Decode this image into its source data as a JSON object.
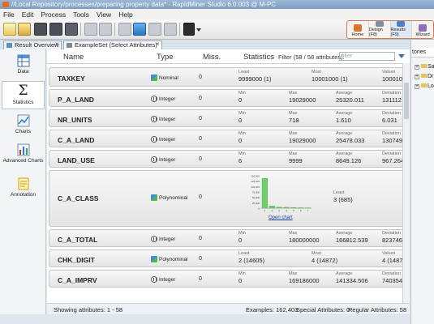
{
  "window": {
    "title": "//Local Repository/processes/preparing property data* - RapidMiner Studio 6.0.003 @ M-PC"
  },
  "menu": [
    "File",
    "Edit",
    "Process",
    "Tools",
    "View",
    "Help"
  ],
  "perspectives": [
    {
      "label": "Home",
      "icon": "home-icon"
    },
    {
      "label": "Design (F8)",
      "icon": "design-icon"
    },
    {
      "label": "Results (F9)",
      "icon": "results-icon"
    },
    {
      "label": "Wizard",
      "icon": "wizard-icon"
    }
  ],
  "tabs": [
    {
      "label": "Result Overview",
      "icon": "result-overview-icon"
    },
    {
      "label": "ExampleSet (Select Attributes)",
      "icon": "exampleset-icon"
    }
  ],
  "sidebar": [
    {
      "label": "Data",
      "icon": "data-table-icon"
    },
    {
      "label": "Statistics",
      "icon": "sigma-icon"
    },
    {
      "label": "Charts",
      "icon": "chart-icon"
    },
    {
      "label": "Advanced Charts",
      "icon": "advanced-chart-icon"
    },
    {
      "label": "Annotation",
      "icon": "annotation-icon"
    }
  ],
  "header": {
    "name": "Name",
    "type": "Type",
    "missing": "Miss.",
    "statistics": "Statistics",
    "filter_label": "Filter (58 / 58 attributes):",
    "filter_placeholder": "filter"
  },
  "rows": [
    {
      "name": "TAXKEY",
      "type": "Nominal",
      "missing": "0",
      "stats": [
        {
          "label": "Least",
          "value": "9999000 (1)"
        },
        {
          "label": "Most",
          "value": "10001000 (1)"
        },
        {
          "label": "Values",
          "value": "100010"
        }
      ]
    },
    {
      "name": "P_A_LAND",
      "type": "Integer",
      "missing": "0",
      "stats": [
        {
          "label": "Min",
          "value": "0"
        },
        {
          "label": "Max",
          "value": "19029000"
        },
        {
          "label": "Average",
          "value": "25320.011"
        },
        {
          "label": "Deviation",
          "value": "131112"
        }
      ]
    },
    {
      "name": "NR_UNITS",
      "type": "Integer",
      "missing": "0",
      "stats": [
        {
          "label": "Min",
          "value": "0"
        },
        {
          "label": "Max",
          "value": "718"
        },
        {
          "label": "Average",
          "value": "1.610"
        },
        {
          "label": "Deviation",
          "value": "6.031"
        }
      ]
    },
    {
      "name": "C_A_LAND",
      "type": "Integer",
      "missing": "0",
      "stats": [
        {
          "label": "Min",
          "value": "0"
        },
        {
          "label": "Max",
          "value": "19029000"
        },
        {
          "label": "Average",
          "value": "25478.033"
        },
        {
          "label": "Deviation",
          "value": "130749"
        }
      ]
    },
    {
      "name": "LAND_USE",
      "type": "Integer",
      "missing": "0",
      "stats": [
        {
          "label": "Min",
          "value": "6"
        },
        {
          "label": "Max",
          "value": "9999"
        },
        {
          "label": "Average",
          "value": "8649.126"
        },
        {
          "label": "Deviation",
          "value": "967.264"
        }
      ]
    },
    {
      "name": "C_A_CLASS",
      "type": "Polynominal",
      "missing": "0",
      "stats": [
        {
          "label": "Least",
          "value": "3 (685)"
        }
      ],
      "open_chart": "Open chart"
    },
    {
      "name": "C_A_TOTAL",
      "type": "Integer",
      "missing": "0",
      "stats": [
        {
          "label": "Min",
          "value": "0"
        },
        {
          "label": "Max",
          "value": "180000000"
        },
        {
          "label": "Average",
          "value": "166812.539"
        },
        {
          "label": "Deviation",
          "value": "823746"
        }
      ]
    },
    {
      "name": "CHK_DIGIT",
      "type": "Polynominal",
      "missing": "0",
      "stats": [
        {
          "label": "Least",
          "value": "2 (14605)"
        },
        {
          "label": "Most",
          "value": "4 (14872)"
        },
        {
          "label": "Values",
          "value": "4 (14872)"
        }
      ]
    },
    {
      "name": "C_A_IMPRV",
      "type": "Integer",
      "missing": "0",
      "stats": [
        {
          "label": "Min",
          "value": "0"
        },
        {
          "label": "Max",
          "value": "169186000"
        },
        {
          "label": "Average",
          "value": "141334.506"
        },
        {
          "label": "Deviation",
          "value": "740354"
        }
      ]
    }
  ],
  "chart_data": {
    "type": "bar",
    "categories": [
      "1",
      "2",
      "3",
      "4",
      "5",
      "6",
      "7"
    ],
    "values": [
      138000,
      10000,
      5000,
      4000,
      3000,
      2000,
      700
    ],
    "ylim": [
      0,
      150000
    ],
    "ytick_labels": [
      "150,000",
      "125,000",
      "100,000",
      "75,000",
      "50,000",
      "25,000",
      "0"
    ],
    "bar_color": "#6fcf6b"
  },
  "statusbar": {
    "showing": "Showing attributes: 1 - 58",
    "examples": "Examples: 162,403",
    "special": "Special Attributes: 0",
    "regular": "Regular Attributes: 58"
  },
  "repository_panel": {
    "tab": "tories",
    "nodes": [
      "Sa",
      "Dr",
      "Lo"
    ]
  }
}
